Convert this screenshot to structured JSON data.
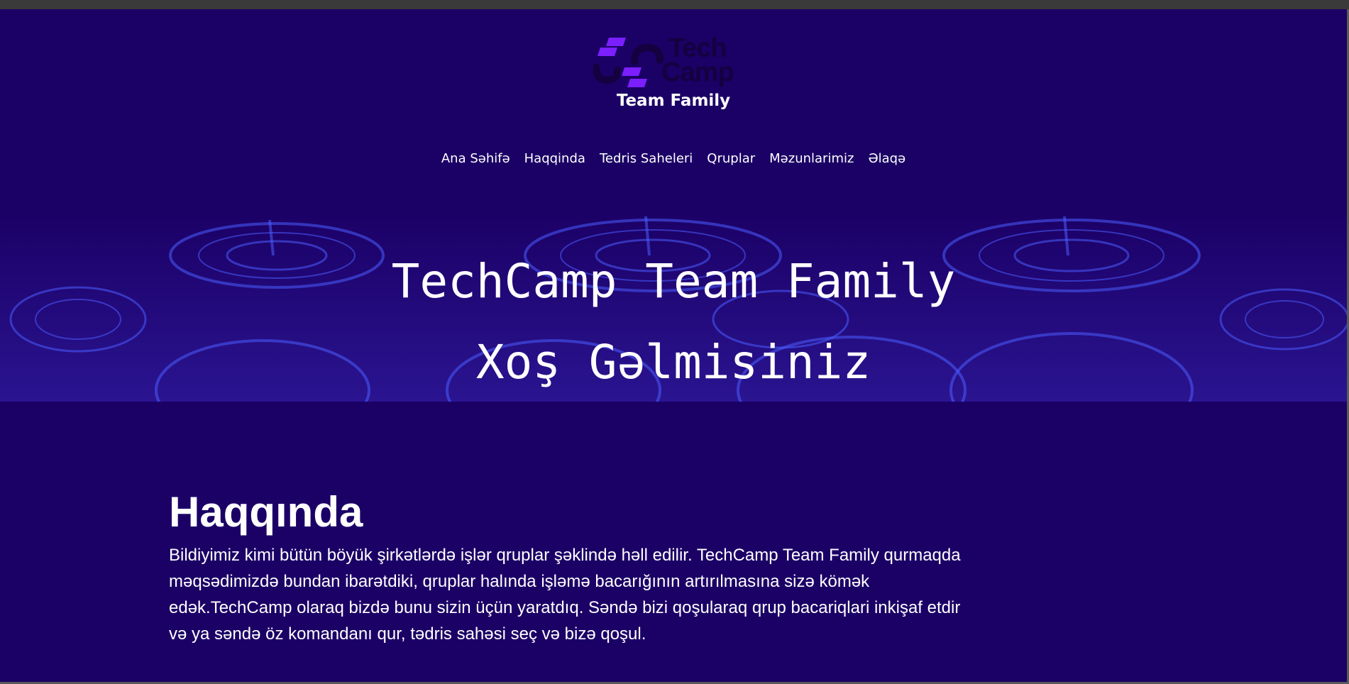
{
  "brand": {
    "logo_text_line1": "Tech",
    "logo_text_line2": "Camp",
    "subtitle": "Team Family",
    "accent_color": "#7b1fff"
  },
  "nav": {
    "items": [
      {
        "label": "Ana Səhifə"
      },
      {
        "label": "Haqqinda"
      },
      {
        "label": "Tedris Saheleri"
      },
      {
        "label": "Qruplar"
      },
      {
        "label": "Məzunlarimiz"
      },
      {
        "label": "Əlaqə"
      }
    ]
  },
  "hero": {
    "line1": "TechCamp Team Family",
    "line2": "Xoş Gəlmisiniz"
  },
  "about": {
    "heading": "Haqqında",
    "body": "Bildiyimiz kimi bütün böyük şirkətlərdə işlər qruplar şəklində həll edilir. TechCamp Team Family qurmaqda məqsədimizdə bundan ibarətdiki, qruplar halında işləmə bacarığının artırılmasına sizə kömək edək.TechCamp olaraq bizdə bunu sizin üçün yaratdıq. Səndə bizi qoşularaq qrup bacariqlari inkişaf etdir və ya səndə öz komandanı qur, tədris sahəsi seç və bizə qoşul."
  },
  "colors": {
    "background": "#1b0066",
    "text": "#ffffff"
  }
}
